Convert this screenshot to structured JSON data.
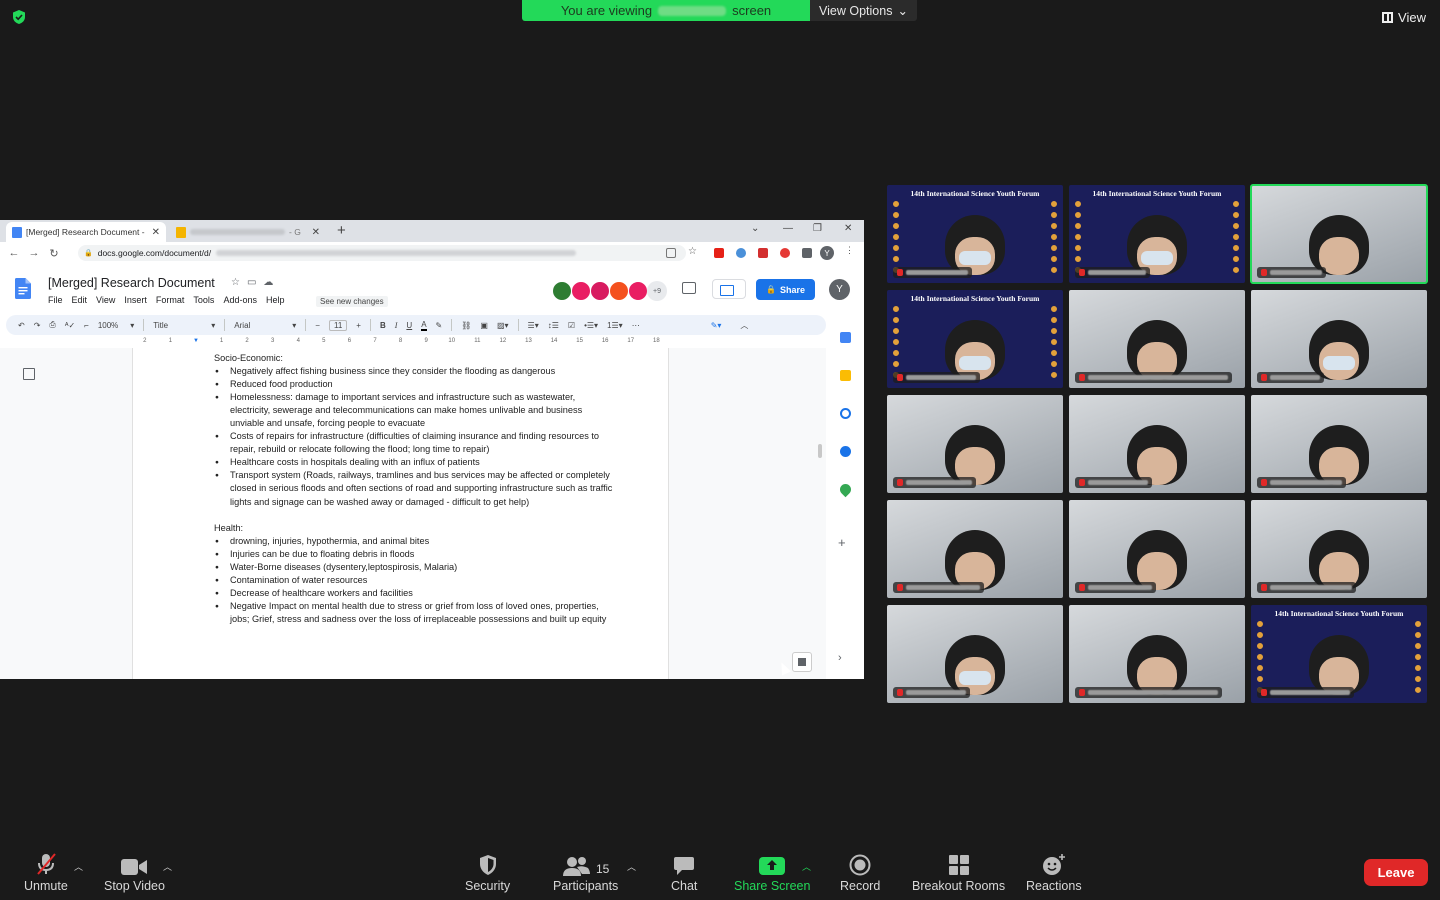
{
  "zoom_top": {
    "viewing_prefix": "You are viewing",
    "viewing_suffix": "screen",
    "view_options": "View Options",
    "view_button": "View"
  },
  "browser": {
    "tab_active": "[Merged] Research Document - G",
    "tab_inactive_suffix": "- G",
    "url": "docs.google.com/document/d/",
    "profile_initial": "Y"
  },
  "docs": {
    "title": "[Merged] Research Document",
    "menus": [
      "File",
      "Edit",
      "View",
      "Insert",
      "Format",
      "Tools",
      "Add-ons",
      "Help"
    ],
    "see_new_changes": "See new changes",
    "more_collaborators": "+9",
    "share_label": "Share",
    "account_initial": "Y",
    "toolbar": {
      "zoom": "100%",
      "style": "Title",
      "font": "Arial",
      "font_size": "11",
      "bold": "B",
      "italic": "I",
      "underline": "U",
      "text_color": "A",
      "more": "⋯"
    },
    "ruler": [
      "2",
      "1",
      "",
      "1",
      "2",
      "3",
      "4",
      "5",
      "6",
      "7",
      "8",
      "9",
      "10",
      "11",
      "12",
      "13",
      "14",
      "15",
      "16",
      "17",
      "18"
    ],
    "content": {
      "section1_heading": "Socio-Economic:",
      "section1_items": [
        "Negatively affect fishing business since they consider the flooding as dangerous",
        "Reduced food production",
        "Homelessness: damage to important services and infrastructure such as wastewater, electricity, sewerage and telecommunications can make homes unlivable and business unviable and unsafe, forcing people to evacuate",
        "Costs of repairs for infrastructure (difficulties of claiming insurance and finding resources to repair, rebuild or relocate following the flood; long time to repair)",
        "Healthcare costs in hospitals dealing with an influx of patients",
        "Transport system (Roads, railways, tramlines and bus services may be affected or completely closed in serious floods and often sections of road and supporting infrastructure such as traffic lights and signage can be washed away or damaged - difficult to get help)"
      ],
      "section2_heading": "Health:",
      "section2_items": [
        "drowning, injuries, hypothermia, and animal bites",
        "Injuries can be due to floating debris in floods",
        "Water-Borne diseases (dysentery,leptospirosis, Malaria)",
        "Contamination of water resources",
        "Decrease of healthcare workers and facilities",
        "Negative Impact on mental health due to stress or grief from loss of loved ones, properties, jobs; Grief, stress and sadness over the loss of irreplaceable possessions and built up equity"
      ]
    }
  },
  "gallery": {
    "banner_text": "14th International Science Youth Forum",
    "tiles": [
      {
        "kind": "banner",
        "mask": true
      },
      {
        "kind": "banner",
        "mask": true
      },
      {
        "kind": "cam",
        "mask": false,
        "speaker": true
      },
      {
        "kind": "banner",
        "mask": true
      },
      {
        "kind": "cam",
        "mask": false
      },
      {
        "kind": "cam",
        "mask": true
      },
      {
        "kind": "cam",
        "mask": false
      },
      {
        "kind": "cam",
        "mask": false
      },
      {
        "kind": "cam",
        "mask": false
      },
      {
        "kind": "cam",
        "mask": false
      },
      {
        "kind": "cam",
        "mask": false
      },
      {
        "kind": "cam",
        "mask": false
      },
      {
        "kind": "cam",
        "mask": true
      },
      {
        "kind": "cam",
        "mask": false
      },
      {
        "kind": "banner",
        "mask": false
      }
    ]
  },
  "controls": {
    "unmute": "Unmute",
    "stop_video": "Stop Video",
    "security": "Security",
    "participants": "Participants",
    "participants_count": "15",
    "chat": "Chat",
    "share_screen": "Share Screen",
    "record": "Record",
    "breakout_rooms": "Breakout Rooms",
    "reactions": "Reactions",
    "leave": "Leave"
  },
  "colors": {
    "zoom_green": "#23d959",
    "leave_red": "#e02828",
    "docs_blue": "#1a73e8",
    "banner_navy": "#1b1e5a"
  }
}
